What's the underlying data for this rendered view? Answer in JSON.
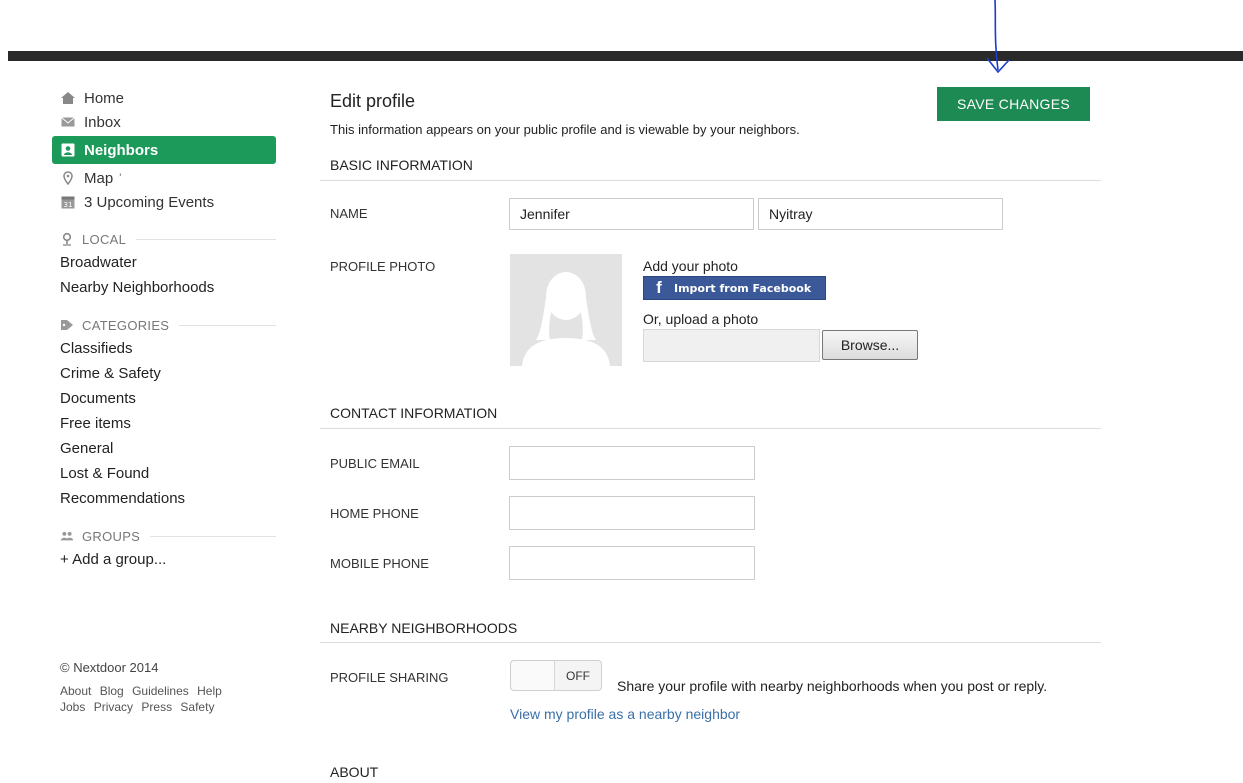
{
  "sidebar": {
    "nav": [
      {
        "label": "Home",
        "icon": "house-icon"
      },
      {
        "label": "Inbox",
        "icon": "envelope-icon"
      },
      {
        "label": "Neighbors",
        "icon": "person-card-icon",
        "active": true
      },
      {
        "label": "Map",
        "icon": "map-pin-icon",
        "suffix": "'"
      },
      {
        "label": "3 Upcoming Events",
        "icon": "calendar-icon"
      }
    ],
    "local": {
      "title": "LOCAL",
      "items": [
        "Broadwater",
        "Nearby Neighborhoods"
      ]
    },
    "categories": {
      "title": "CATEGORIES",
      "items": [
        "Classifieds",
        "Crime & Safety",
        "Documents",
        "Free items",
        "General",
        "Lost & Found",
        "Recommendations"
      ]
    },
    "groups": {
      "title": "GROUPS",
      "add": "+ Add a group..."
    },
    "footer": {
      "copyright": "© Nextdoor 2014",
      "links_row1": [
        "About",
        "Blog",
        "Guidelines",
        "Help"
      ],
      "links_row2": [
        "Jobs",
        "Privacy",
        "Press",
        "Safety"
      ]
    }
  },
  "main": {
    "title": "Edit profile",
    "subtitle": "This information appears on your public profile and is viewable by your neighbors.",
    "save_label": "SAVE CHANGES",
    "basic": {
      "title": "BASIC INFORMATION",
      "name_label": "NAME",
      "first_name": "Jennifer",
      "last_name": "Nyitray",
      "photo_label": "PROFILE PHOTO",
      "add_photo": "Add your photo",
      "facebook_label": "Import from Facebook",
      "upload_label": "Or, upload a photo",
      "browse_label": "Browse..."
    },
    "contact": {
      "title": "CONTACT INFORMATION",
      "email_label": "PUBLIC EMAIL",
      "email_value": "",
      "home_label": "HOME PHONE",
      "home_value": "",
      "mobile_label": "MOBILE PHONE",
      "mobile_value": ""
    },
    "nearby": {
      "title": "NEARBY NEIGHBORHOODS",
      "sharing_label": "PROFILE SHARING",
      "toggle_state": "OFF",
      "share_text": "Share your profile with nearby neighborhoods when you post or reply.",
      "view_link": "View my profile as a nearby neighbor"
    },
    "about": {
      "title": "ABOUT"
    }
  },
  "colors": {
    "accent": "#1c9a5a",
    "save_button": "#1c8a52",
    "link": "#3a6fa8",
    "facebook": "#3b5998",
    "annotation": "#1a3ccc"
  }
}
